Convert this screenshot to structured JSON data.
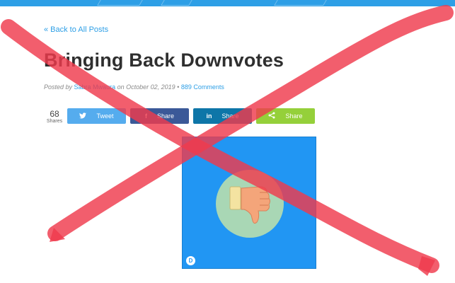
{
  "nav": {
    "back_label": "« Back to All Posts"
  },
  "post": {
    "title": "Bringing Back Downvotes",
    "meta_prefix": "Posted by",
    "author": "Sabra Mwaura",
    "meta_date": "on October 02, 2019 •",
    "comments": "889 Comments"
  },
  "share": {
    "count": "68",
    "count_label": "Shares",
    "buttons": [
      {
        "label": "Tweet",
        "icon": "twitter-icon",
        "color": "#55acee"
      },
      {
        "label": "Share",
        "icon": "facebook-icon",
        "color": "#3b5998"
      },
      {
        "label": "Share",
        "icon": "linkedin-icon",
        "color": "#0e76a8"
      },
      {
        "label": "Share",
        "icon": "share-icon",
        "color": "#95d03a"
      }
    ]
  },
  "hero": {
    "background": "#2196f3",
    "icon": "thumbs-down-icon",
    "badge_icon": "disqus-logo-icon"
  },
  "overlay": {
    "icon": "red-x-cross-icon",
    "color": "#ef3b4d"
  },
  "colors": {
    "accent": "#2e9fe6",
    "title": "#2f2f2f"
  }
}
